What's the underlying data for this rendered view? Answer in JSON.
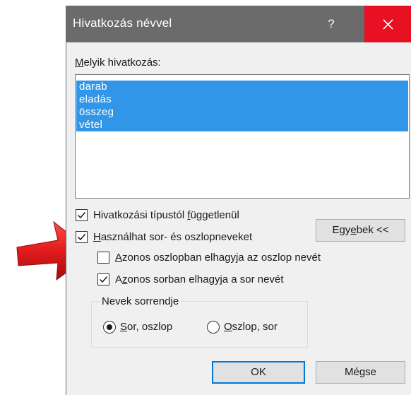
{
  "dialog": {
    "title": "Hivatkozás névvel",
    "help_label": "?",
    "list_label_access": "M",
    "list_label_rest": "elyik hivatkozás:",
    "list_items": [
      "darab",
      "eladás",
      "összeg",
      "vétel"
    ],
    "options": {
      "ignore_ref_type": {
        "pre": "Hivatkozási típustól ",
        "access": "f",
        "post": "üggetlenül",
        "checked": true
      },
      "use_row_col_names": {
        "access": "H",
        "post": "asználhat sor- és oszlopneveket",
        "checked": true
      },
      "omit_col_name": {
        "access": "A",
        "post": "zonos oszlopban elhagyja az oszlop nevét",
        "checked": false
      },
      "omit_row_name": {
        "pre": "A",
        "access": "z",
        "post": "onos sorban elhagyja a sor nevét",
        "checked": true
      }
    },
    "more_button": {
      "pre": "Egy",
      "access": "e",
      "post": "bek <<"
    },
    "name_order": {
      "legend": "Nevek sorrendje",
      "row_col": {
        "access": "S",
        "post": "or, oszlop",
        "selected": true
      },
      "col_row": {
        "access": "O",
        "post": "szlop, sor",
        "selected": false
      }
    },
    "ok_label": "OK",
    "cancel_label": "Mégse"
  },
  "colors": {
    "titlebar": "#6b6b6b",
    "close": "#e81123",
    "selection": "#3296e8",
    "arrow": "#e11b1b"
  }
}
